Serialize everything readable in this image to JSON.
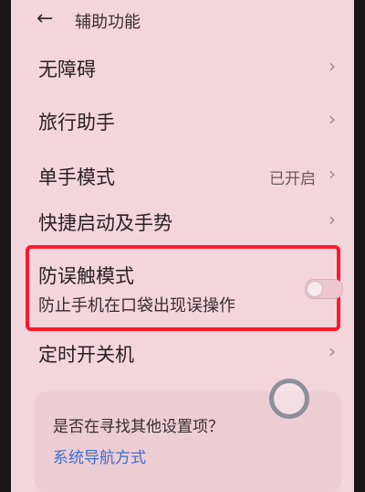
{
  "header": {
    "back_icon": "←",
    "title": "辅助功能"
  },
  "rows": [
    {
      "label": "无障碍",
      "value": ""
    },
    {
      "label": "旅行助手",
      "value": ""
    },
    {
      "label": "单手模式",
      "value": "已开启"
    },
    {
      "label": "快捷启动及手势",
      "value": ""
    },
    {
      "label": "定时开关机",
      "value": ""
    }
  ],
  "chevron": "›",
  "pocket_mode": {
    "title": "防误触模式",
    "description": "防止手机在口袋出现误操作",
    "enabled": false
  },
  "suggestion_card": {
    "question": "是否在寻找其他设置项？",
    "link": "系统导航方式"
  },
  "colors": {
    "background": "#f3d5dc",
    "highlight": "#ff1a2a",
    "link": "#3b6fd0"
  }
}
